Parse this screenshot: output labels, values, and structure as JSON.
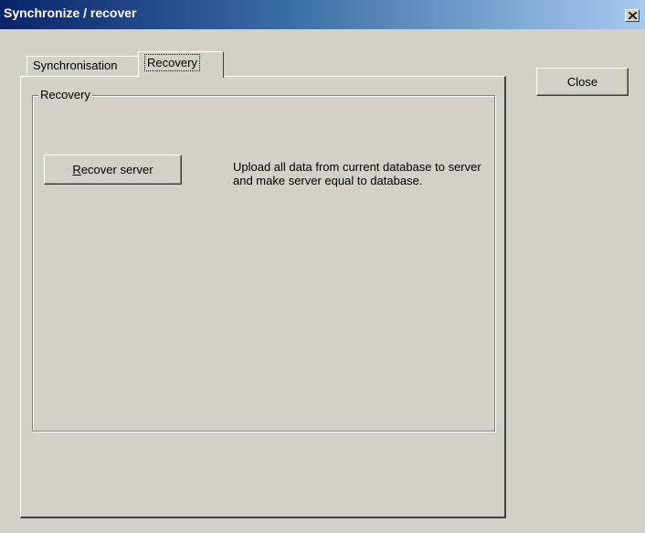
{
  "window": {
    "title": "Synchronize / recover"
  },
  "tabs": [
    {
      "label": "Synchronisation",
      "selected": false
    },
    {
      "label": "Recovery",
      "selected": true
    }
  ],
  "recovery_group": {
    "label": "Recovery",
    "recover_button": {
      "label_first": "R",
      "label_rest": "ecover server"
    },
    "description": "Upload all data from current database to server and make server equal to database."
  },
  "close_button": {
    "label": "Close"
  },
  "colors": {
    "face": "#d4d0c8",
    "titlebar_start": "#0a246a",
    "titlebar_end": "#a6caf0"
  }
}
